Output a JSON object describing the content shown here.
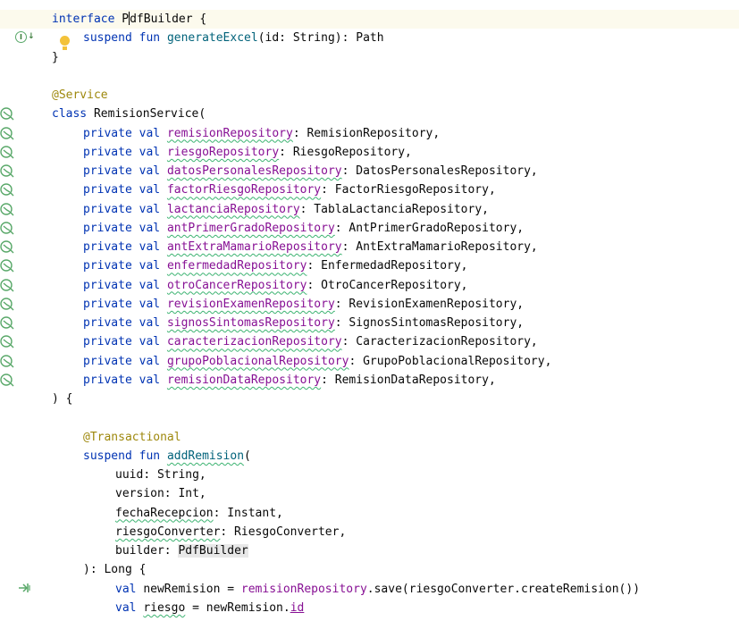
{
  "colors": {
    "keyword": "#0033b3",
    "function": "#00627a",
    "annotation": "#9e880d",
    "property": "#871094",
    "text": "#080808",
    "current_line": "#fcfaed",
    "gutter_icon": "#59a869"
  },
  "gutter": {
    "implement_icons": [
      "implemented-interface-icon",
      "implemented-method-icon"
    ],
    "bean_icon": "spring-bean-icon",
    "intention_icon": "lightbulb-icon",
    "suspend_call_icon": "suspend-call-icon"
  },
  "code": {
    "line_01": {
      "kw": "interface",
      "name_a": "P",
      "name_b": "dfBuilder",
      "brace": "{"
    },
    "line_02": {
      "kw1": "suspend",
      "kw2": "fun",
      "fn": "generateExcel",
      "params": "(id: String): Path"
    },
    "line_03": {
      "text": "}"
    },
    "line_05": {
      "anno": "@Service"
    },
    "line_06": {
      "kw": "class",
      "name": "RemisionService",
      "paren": "("
    },
    "params": [
      {
        "mod": "private",
        "kw": "val",
        "name": "remisionRepository",
        "type": ": RemisionRepository,"
      },
      {
        "mod": "private",
        "kw": "val",
        "name": "riesgoRepository",
        "type": ": RiesgoRepository,"
      },
      {
        "mod": "private",
        "kw": "val",
        "name": "datosPersonalesRepository",
        "type": ": DatosPersonalesRepository,"
      },
      {
        "mod": "private",
        "kw": "val",
        "name": "factorRiesgoRepository",
        "type": ": FactorRiesgoRepository,"
      },
      {
        "mod": "private",
        "kw": "val",
        "name": "lactanciaRepository",
        "type": ": TablaLactanciaRepository,"
      },
      {
        "mod": "private",
        "kw": "val",
        "name": "antPrimerGradoRepository",
        "type": ": AntPrimerGradoRepository,"
      },
      {
        "mod": "private",
        "kw": "val",
        "name": "antExtraMamarioRepository",
        "type": ": AntExtraMamarioRepository,"
      },
      {
        "mod": "private",
        "kw": "val",
        "name": "enfermedadRepository",
        "type": ": EnfermedadRepository,"
      },
      {
        "mod": "private",
        "kw": "val",
        "name": "otroCancerRepository",
        "type": ": OtroCancerRepository,"
      },
      {
        "mod": "private",
        "kw": "val",
        "name": "revisionExamenRepository",
        "type": ": RevisionExamenRepository,"
      },
      {
        "mod": "private",
        "kw": "val",
        "name": "signosSintomasRepository",
        "type": ": SignosSintomasRepository,"
      },
      {
        "mod": "private",
        "kw": "val",
        "name": "caracterizacionRepository",
        "type": ": CaracterizacionRepository,"
      },
      {
        "mod": "private",
        "kw": "val",
        "name": "grupoPoblacionalRepository",
        "type": ": GrupoPoblacionalRepository,"
      },
      {
        "mod": "private",
        "kw": "val",
        "name": "remisionDataRepository",
        "type": ": RemisionDataRepository,"
      }
    ],
    "line_21": {
      "text": ") {"
    },
    "line_23": {
      "anno": "@Transactional"
    },
    "line_24": {
      "kw1": "suspend",
      "kw2": "fun",
      "fn": "addRemision",
      "paren": "("
    },
    "fn_params": [
      {
        "name": "uuid",
        "type": ": String,"
      },
      {
        "name": "version",
        "type": ": Int,"
      },
      {
        "name": "fechaRecepcion",
        "type": ": Instant,"
      },
      {
        "name": "riesgoConverter",
        "type": ": RiesgoConverter,"
      },
      {
        "name": "builder",
        "type": ": ",
        "type_name": "PdfBuilder"
      }
    ],
    "line_30": {
      "text": "): Long {"
    },
    "line_31": {
      "kw": "val",
      "name": "newRemision",
      "eq": " = ",
      "prop": "remisionRepository",
      "rest": ".save(riesgoConverter.createRemision())"
    },
    "line_32": {
      "kw": "val",
      "name": "riesgo",
      "eq": " = newRemision.",
      "prop": "id"
    }
  }
}
